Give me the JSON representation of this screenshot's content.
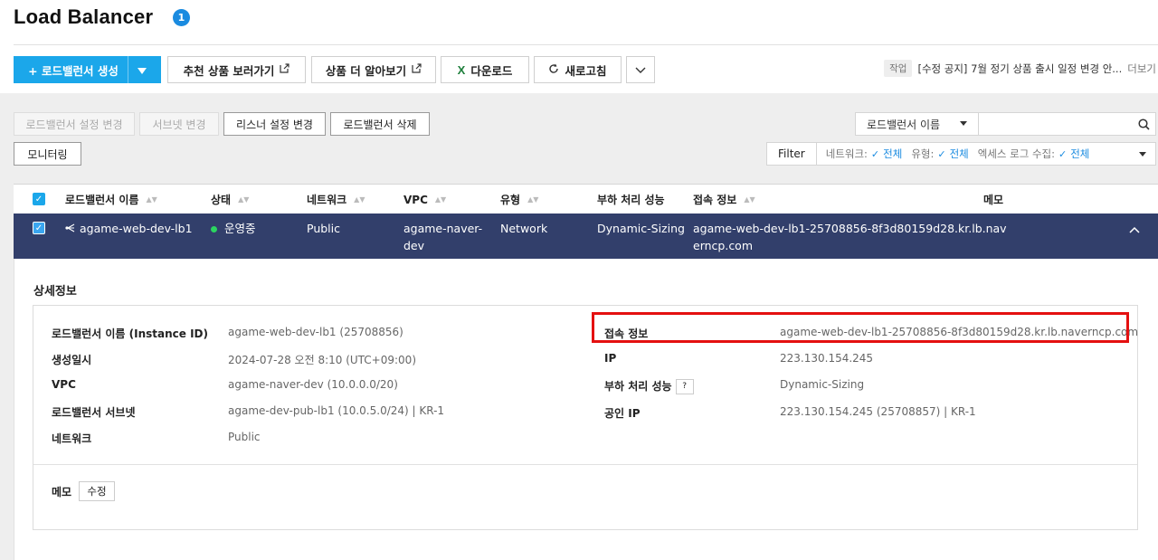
{
  "header": {
    "title": "Load Balancer",
    "badge": "1",
    "create_button": "+ 로드밸런서 생성",
    "recommend_button": "추천 상품 보러가기",
    "learn_more_button": "상품 더 알아보기",
    "download_button": "다운로드",
    "refresh_button": "새로고침"
  },
  "notice": {
    "tag": "작업",
    "text": "[수정 공지] 7월 정기 상품 출시 일정 변경 안...",
    "more": "더보기"
  },
  "actions": {
    "change_lb_settings": "로드밸런서 설정 변경",
    "change_subnet": "서브넷 변경",
    "change_listener": "리스너 설정 변경",
    "delete_lb": "로드밸런서 삭제",
    "monitoring": "모니터링"
  },
  "search": {
    "select_value": "로드밸런서 이름",
    "placeholder": ""
  },
  "filter": {
    "label": "Filter",
    "network_key": "네트워크:",
    "network_val": "전체",
    "type_key": "유형:",
    "type_val": "전체",
    "access_log_key": "엑세스 로그 수집:",
    "access_log_val": "전체"
  },
  "table": {
    "columns": {
      "name": "로드밸런서 이름",
      "status": "상태",
      "network": "네트워크",
      "vpc": "VPC",
      "type": "유형",
      "performance": "부하 처리 성능",
      "access": "접속 정보",
      "memo": "메모"
    },
    "row": {
      "name": "agame-web-dev-lb1",
      "status": "운영중",
      "network": "Public",
      "vpc_line1": "agame-naver-",
      "vpc_line2": "dev",
      "type": "Network",
      "performance": "Dynamic-Sizing",
      "access_line1": "agame-web-dev-lb1-25708856-8f3d80159d28.kr.lb.nav",
      "access_line2": "erncp.com"
    }
  },
  "detail": {
    "title": "상세정보",
    "left": [
      {
        "key": "로드밸런서 이름 (Instance ID)",
        "value": "agame-web-dev-lb1 (25708856)"
      },
      {
        "key": "생성일시",
        "value": "2024-07-28 오전 8:10 (UTC+09:00)"
      },
      {
        "key": "VPC",
        "value": "agame-naver-dev (10.0.0.0/20)"
      },
      {
        "key": "로드밸런서 서브넷",
        "value": "agame-dev-pub-lb1 (10.0.5.0/24) | KR-1"
      },
      {
        "key": "네트워크",
        "value": "Public"
      }
    ],
    "right": [
      {
        "key": "접속 정보",
        "value": "agame-web-dev-lb1-25708856-8f3d80159d28.kr.lb.naverncp.com"
      },
      {
        "key": "IP",
        "value": "223.130.154.245"
      },
      {
        "key": "부하 처리 성능",
        "value": "Dynamic-Sizing"
      },
      {
        "key": "공인 IP",
        "value": "223.130.154.245 (25708857) | KR-1"
      }
    ],
    "memo_key": "메모",
    "memo_edit": "수정"
  },
  "colors": {
    "primary": "#1ba7ea",
    "selected_row": "#323f6b",
    "highlight": "#e41010",
    "status_running": "#2bd560",
    "excel_green": "#1e7f3c"
  }
}
